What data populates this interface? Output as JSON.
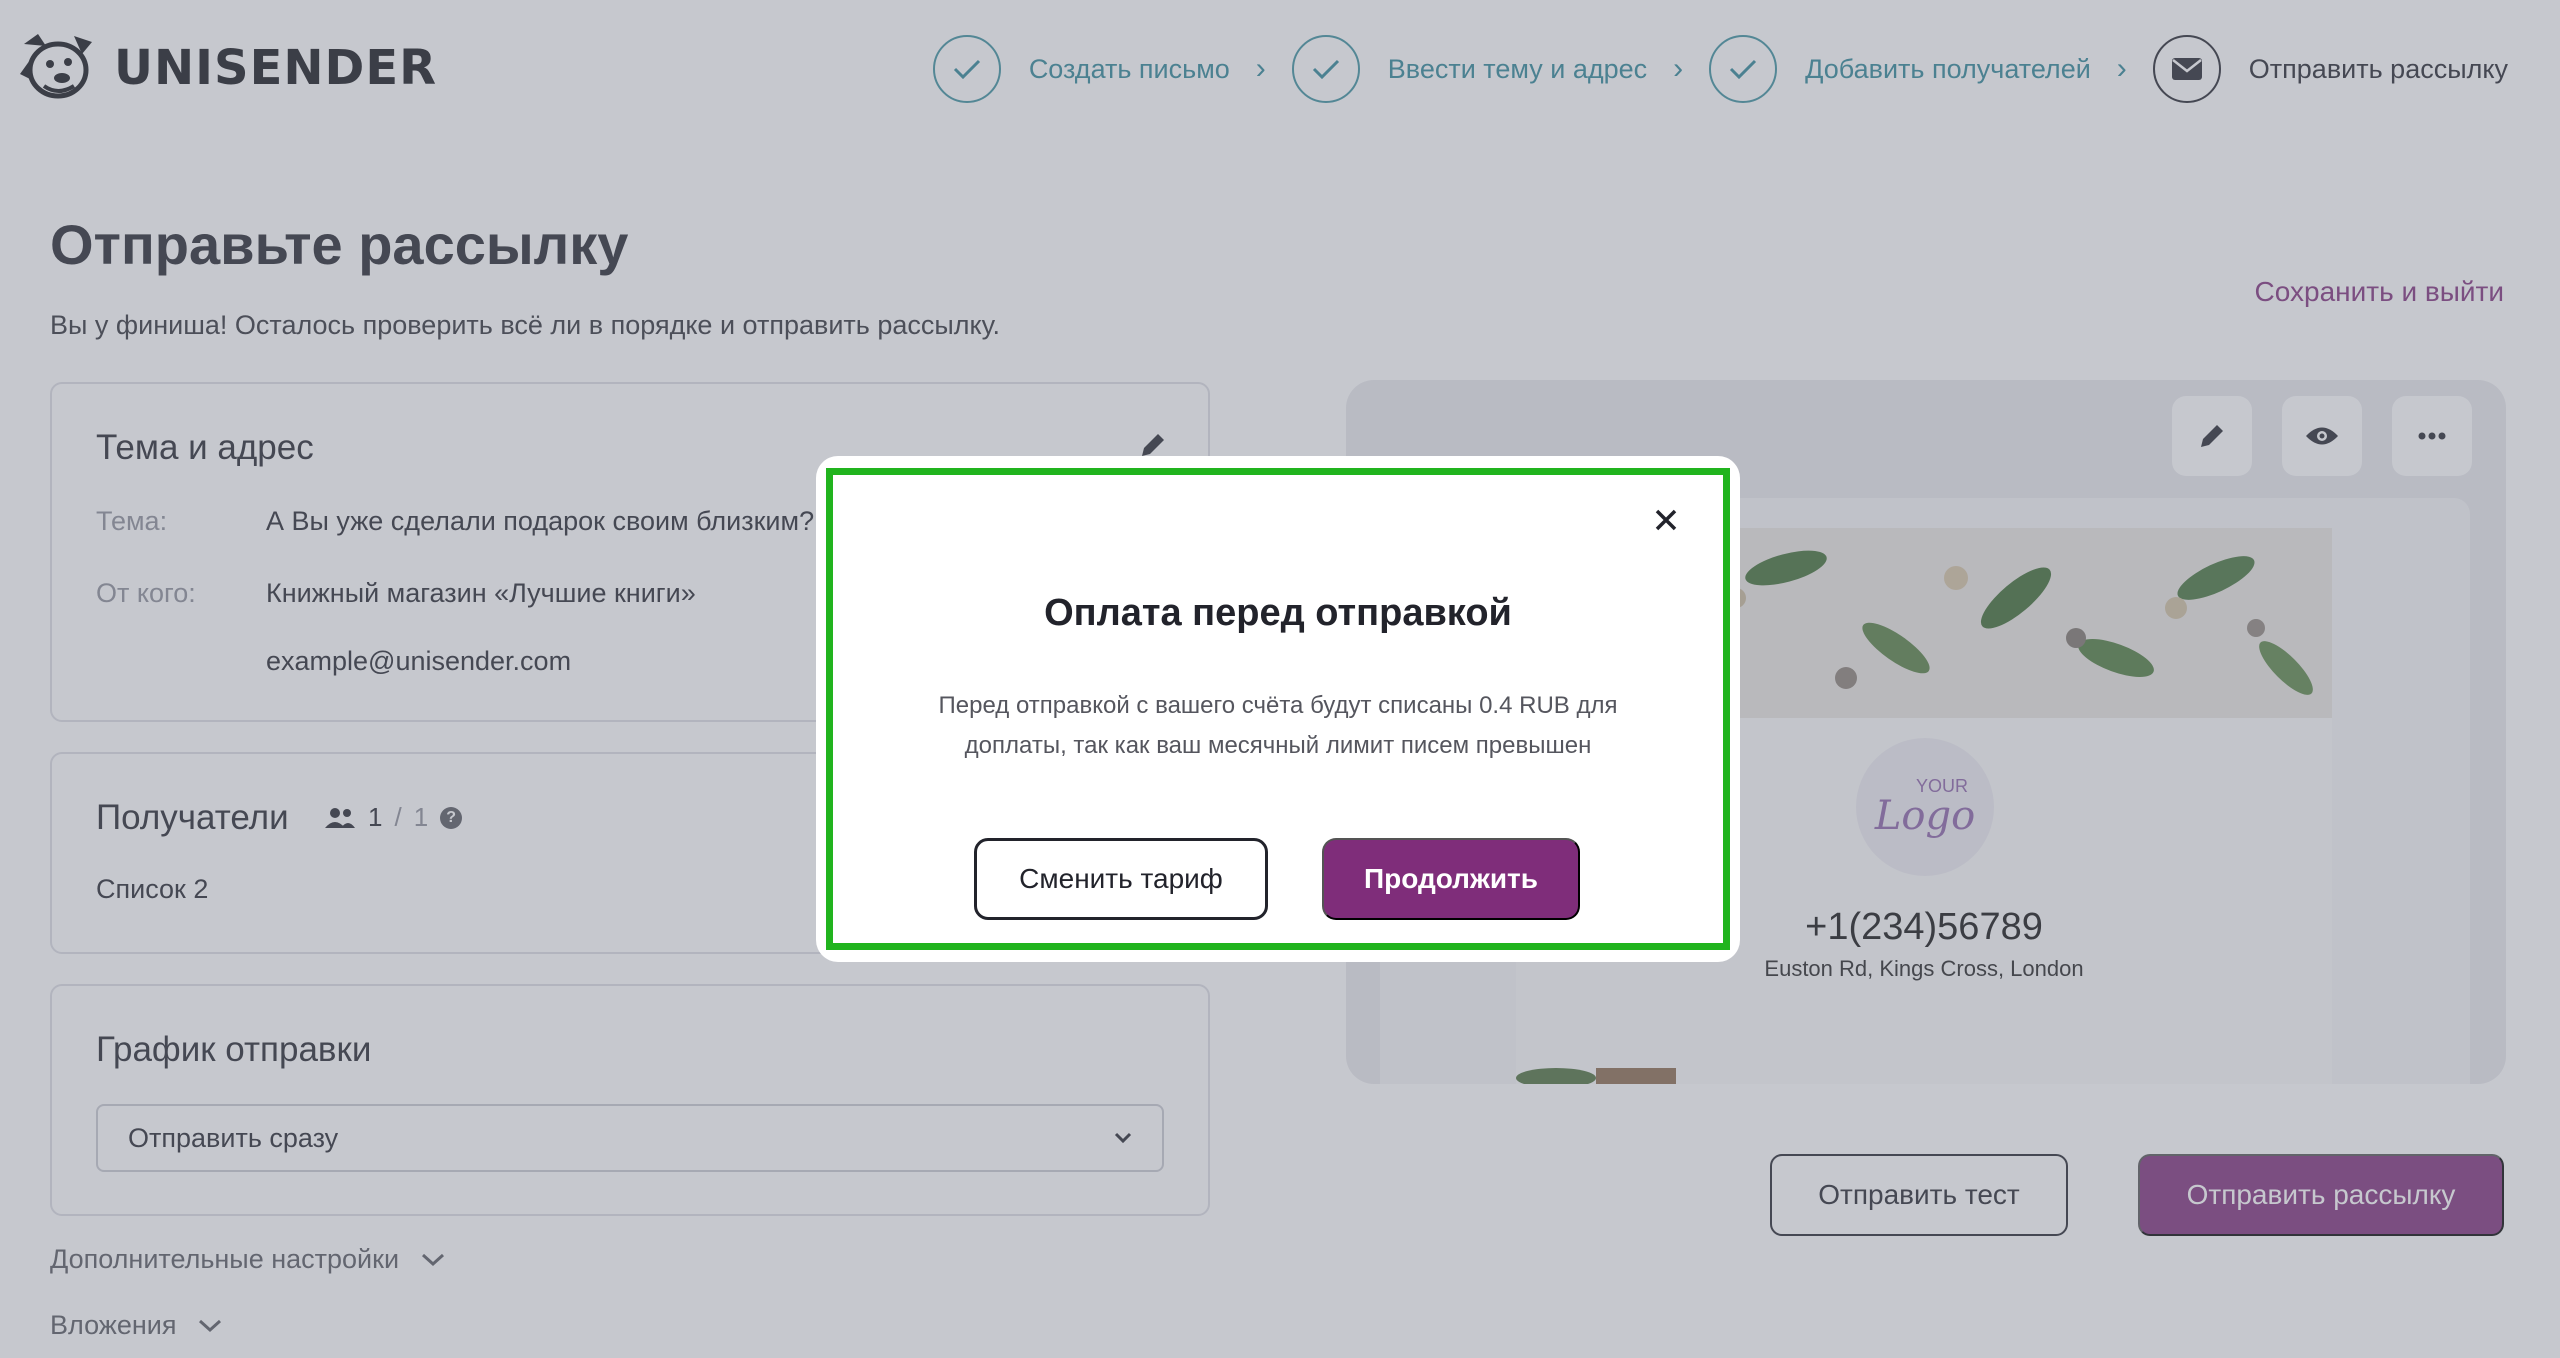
{
  "brand": {
    "name": "UNISENDER"
  },
  "steps": [
    {
      "label": "Создать письмо",
      "state": "done"
    },
    {
      "label": "Ввести тему и адрес",
      "state": "done"
    },
    {
      "label": "Добавить получателей",
      "state": "done"
    },
    {
      "label": "Отправить рассылку",
      "state": "current"
    }
  ],
  "page": {
    "title": "Отправьте рассылку",
    "subtitle": "Вы у финиша! Осталось проверить всё ли в порядке и отправить рассылку.",
    "save_exit": "Сохранить и выйти"
  },
  "subject_card": {
    "title": "Тема и адрес",
    "subject_label": "Тема:",
    "subject_value": "А Вы уже сделали подарок своим близким?",
    "from_label": "От кого:",
    "from_name": "Книжный магазин «Лучшие книги»",
    "from_email": "example@unisender.com"
  },
  "recipients_card": {
    "title": "Получатели",
    "count": "1",
    "total": "1",
    "list_name": "Список 2"
  },
  "schedule_card": {
    "title": "График отправки",
    "selected": "Отправить сразу"
  },
  "extra": {
    "advanced_settings": "Дополнительные настройки",
    "attachments": "Вложения"
  },
  "preview": {
    "logo_your": "YOUR",
    "logo_word": "Logo",
    "phone": "+1(234)56789",
    "address": "Euston Rd, Kings Cross, London"
  },
  "actions": {
    "send_test": "Отправить тест",
    "send": "Отправить рассылку"
  },
  "modal": {
    "title": "Оплата перед отправкой",
    "text": "Перед отправкой с вашего счёта будут списаны 0.4 RUB для доплаты, так как ваш месячный лимит писем превышен",
    "change_plan": "Сменить тариф",
    "continue": "Продолжить"
  },
  "colors": {
    "accent": "#7f2d7a",
    "step_done": "#2c8596",
    "highlight_frame": "#21b41e"
  }
}
